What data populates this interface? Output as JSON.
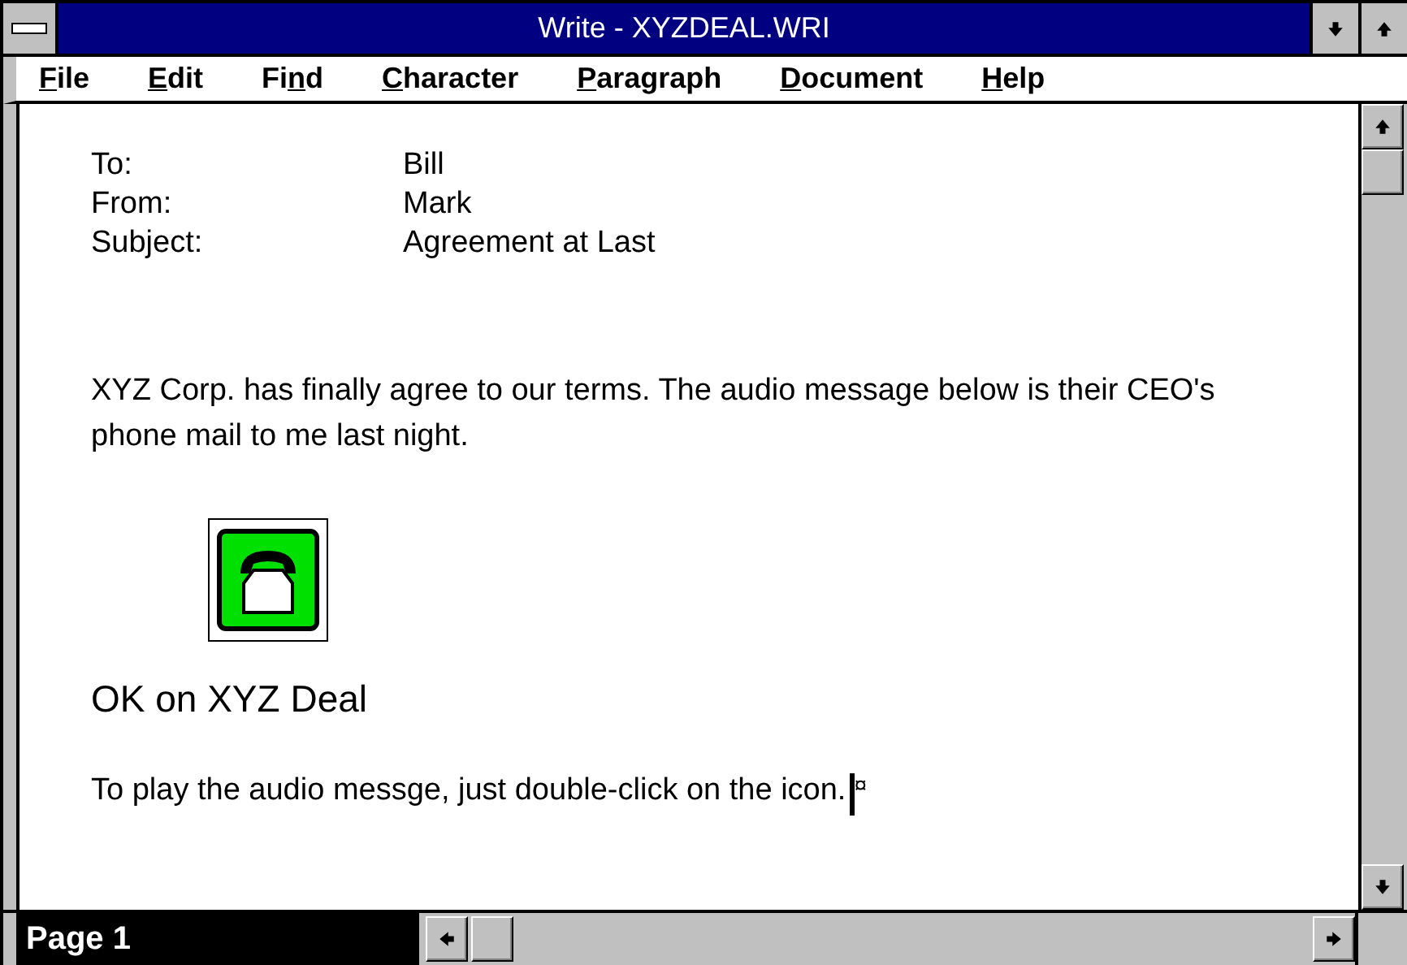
{
  "window": {
    "title": "Write - XYZDEAL.WRI"
  },
  "menu": [
    {
      "access_key": "F",
      "after": "ile"
    },
    {
      "access_key": "E",
      "after": "dit"
    },
    {
      "before": "Fi",
      "access_key": "n",
      "after": "d"
    },
    {
      "access_key": "C",
      "after": "haracter"
    },
    {
      "access_key": "P",
      "after": "aragraph"
    },
    {
      "access_key": "D",
      "after": "ocument"
    },
    {
      "access_key": "H",
      "after": "elp"
    }
  ],
  "document": {
    "header": [
      {
        "field": "To:",
        "value": "Bill"
      },
      {
        "field": "From:",
        "value": "Mark"
      },
      {
        "field": "Subject:",
        "value": "Agreement at Last"
      }
    ],
    "paragraph": "XYZ Corp. has finally agree to our terms.  The audio message below is their CEO's phone mail to me last night.",
    "attachment": {
      "caption": "OK on XYZ Deal"
    },
    "closing": "To play the audio messge, just double-click on the icon.",
    "end_mark": "¤"
  },
  "status_bar": {
    "page": "Page 1"
  }
}
